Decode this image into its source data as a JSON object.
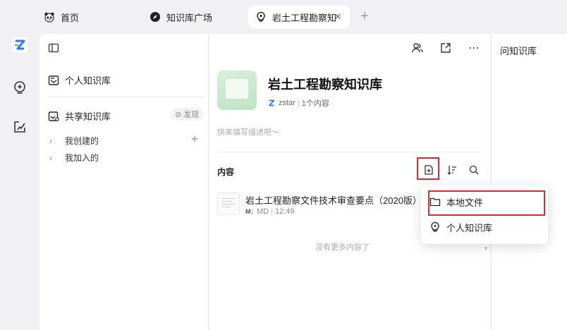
{
  "tabs": [
    {
      "label": "首页",
      "icon": "panda-icon"
    },
    {
      "label": "知识库广场",
      "icon": "compass-icon"
    },
    {
      "label": "岩土工程勘察知识库",
      "icon": "bulb-icon",
      "active": true
    }
  ],
  "rail": [
    "app-logo-icon",
    "bulb-icon",
    "edit-icon"
  ],
  "sidebar": {
    "personal_kb": "个人知识库",
    "shared_kb": "共享知识库",
    "discover": "发现",
    "created": "我创建的",
    "joined": "我加入的"
  },
  "main": {
    "kb_title": "岩土工程勘察知识库",
    "owner": "zstar",
    "count": "1个内容",
    "desc_placeholder": "快来填写描述吧～",
    "section_title": "内容",
    "file": {
      "name": "岩土工程勘察文件技术审查要点（2020版）",
      "type": "MD",
      "time": "12:49"
    },
    "no_more": "没有更多内容了"
  },
  "right_panel": {
    "title": "问知识库"
  },
  "dropdown": {
    "local_file": "本地文件",
    "personal_kb": "个人知识库"
  },
  "colors": {
    "accent": "#2f7cf6",
    "highlight": "#d32f2f",
    "cover": "#cdeacf"
  }
}
